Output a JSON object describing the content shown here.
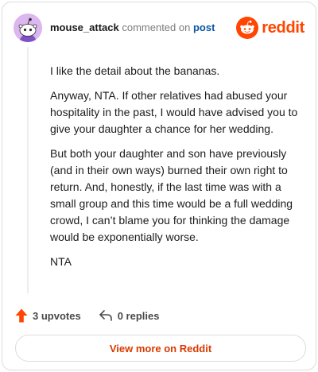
{
  "header": {
    "username": "mouse_attack",
    "action_text": "commented on",
    "post_link": "post",
    "brand_name": "reddit",
    "avatar_icon": "snoo-avatar-icon",
    "brand_icon": "reddit-snoo-icon"
  },
  "comment": {
    "paragraphs": [
      "I like the detail about the bananas.",
      "Anyway, NTA. If other relatives had abused your hospitality in the past, I would have advised you to give your daughter a chance for her wedding.",
      "But both your daughter and son have previously (and in their own ways) burned their own right to return. And, honestly, if the last time was with a small group and this time would be a full wedding crowd, I can’t blame you for thinking the damage would be exponentially worse.",
      "NTA"
    ]
  },
  "actions": {
    "upvotes_label": "3 upvotes",
    "replies_label": "0 replies",
    "upvote_icon": "upvote-arrow-icon",
    "reply_icon": "reply-arrow-icon"
  },
  "footer": {
    "view_more_label": "View more on Reddit"
  },
  "colors": {
    "brand": "#ff4500",
    "link": "#0b57a3",
    "avatar_bg": "#dcb6ef",
    "button_text": "#d93a00"
  }
}
